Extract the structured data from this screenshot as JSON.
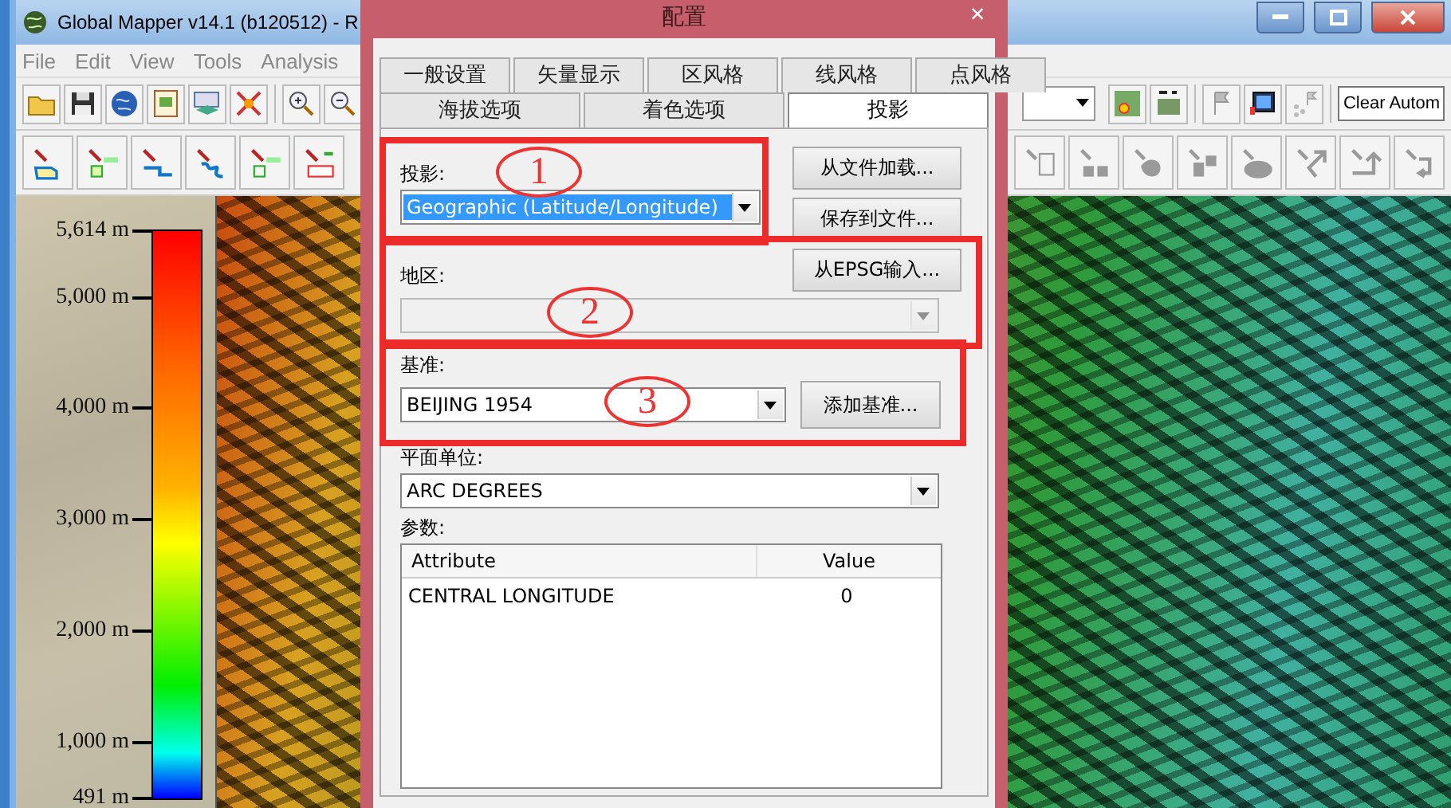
{
  "main_window": {
    "title": "Global Mapper v14.1 (b120512) - R",
    "menu": [
      "File",
      "Edit",
      "View",
      "Tools",
      "Analysis"
    ],
    "toolbar_field": "Clear Autom"
  },
  "legend": {
    "ticks": [
      "5,614 m",
      "5,000 m",
      "4,000 m",
      "3,000 m",
      "2,000 m",
      "1,000 m",
      "491 m"
    ]
  },
  "dialog": {
    "title": "配置",
    "close": "×",
    "tabs_row_1": [
      {
        "label": "一般设置",
        "selected": false
      },
      {
        "label": "矢量显示",
        "selected": false
      },
      {
        "label": "区风格",
        "selected": false
      },
      {
        "label": "线风格",
        "selected": false
      },
      {
        "label": "点风格",
        "selected": false
      }
    ],
    "tabs_row_2": [
      {
        "label": "海拔选项",
        "selected": false
      },
      {
        "label": "着色选项",
        "selected": false
      },
      {
        "label": "投影",
        "selected": true
      }
    ],
    "projection": {
      "label": "投影:",
      "value": "Geographic (Latitude/Longitude)",
      "highlighted": true
    },
    "buttons": [
      "从文件加载...",
      "保存到文件...",
      "从EPSG输入..."
    ],
    "zone": {
      "label": "地区:",
      "disabled": true
    },
    "datum": {
      "label": "基准:",
      "value": "BEIJING 1954",
      "button": "添加基准..."
    },
    "units": {
      "label": "平面单位:",
      "value": "ARC DEGREES"
    },
    "parameters": {
      "label": "参数:",
      "columns": [
        "Attribute",
        "Value"
      ],
      "rows": [
        [
          "CENTRAL LONGITUDE",
          "0"
        ]
      ]
    }
  },
  "annotations": [
    "1",
    "2",
    "3"
  ]
}
